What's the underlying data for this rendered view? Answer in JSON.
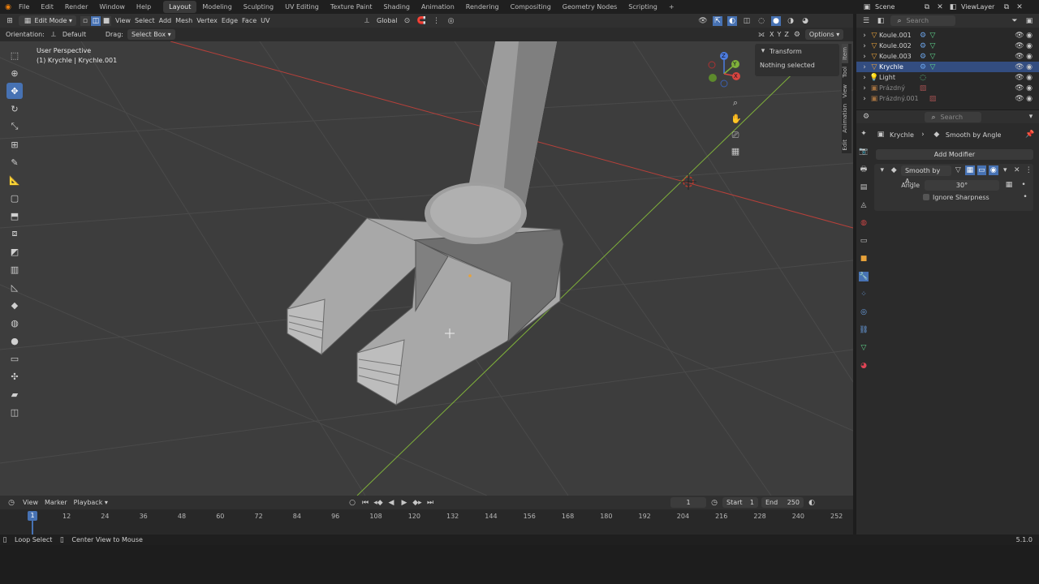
{
  "menubar": {
    "file": "File",
    "edit": "Edit",
    "render": "Render",
    "window": "Window",
    "help": "Help",
    "workspaces": [
      "Layout",
      "Modeling",
      "Sculpting",
      "UV Editing",
      "Texture Paint",
      "Shading",
      "Animation",
      "Rendering",
      "Compositing",
      "Geometry Nodes",
      "Scripting"
    ],
    "add_tab": "+",
    "scene": "Scene",
    "view_layer": "ViewLayer"
  },
  "viewport_header": {
    "mode": "Edit Mode",
    "view": "View",
    "select": "Select",
    "add": "Add",
    "mesh": "Mesh",
    "vertex": "Vertex",
    "edge": "Edge",
    "face": "Face",
    "uv": "UV",
    "transform_orientation": "Global",
    "orientation_label": "Orientation:",
    "orientation_value": "Default",
    "drag_label": "Drag:",
    "drag_value": "Select Box",
    "axes": [
      "X",
      "Y",
      "Z"
    ],
    "options": "Options"
  },
  "viewport": {
    "perspective": "User Perspective",
    "object_info": "(1) Krychle | Krychle.001",
    "n_panel": {
      "section": "Transform",
      "message": "Nothing selected",
      "tabs": [
        "Item",
        "Tool",
        "View",
        "Animation",
        "Edit"
      ]
    },
    "gizmo": {
      "x": "X",
      "y": "Y",
      "z": "Z"
    }
  },
  "outliner": {
    "search_placeholder": "Search",
    "items": [
      {
        "name": "Koule.001"
      },
      {
        "name": "Koule.002"
      },
      {
        "name": "Koule.003"
      },
      {
        "name": "Krychle"
      },
      {
        "name": "Light"
      },
      {
        "name": "Prázdný"
      },
      {
        "name": "Prázdný.001"
      }
    ]
  },
  "properties": {
    "search_placeholder": "Search",
    "breadcrumb_object": "Krychle",
    "breadcrumb_modifier": "Smooth by Angle",
    "add_modifier": "Add Modifier",
    "modifier_name": "Smooth by A...",
    "angle_label": "Angle",
    "angle_value": "30°",
    "ignore_sharpness": "Ignore Sharpness"
  },
  "timeline": {
    "view": "View",
    "marker": "Marker",
    "playback": "Playback",
    "current_frame": "1",
    "start_label": "Start",
    "start_value": "1",
    "end_label": "End",
    "end_value": "250",
    "ticks": [
      "12",
      "24",
      "36",
      "48",
      "60",
      "72",
      "84",
      "96",
      "108",
      "120",
      "132",
      "144",
      "156",
      "168",
      "180",
      "192",
      "204",
      "216",
      "228",
      "240",
      "252"
    ],
    "playhead": "1"
  },
  "statusbar": {
    "hint1": "Loop Select",
    "hint2": "Center View to Mouse",
    "version": "5.1.0"
  },
  "colors": {
    "accent": "#4772b3",
    "viewport_bg": "#3d3d3d",
    "x_axis": "#c0392b",
    "y_axis": "#7fb03a"
  }
}
